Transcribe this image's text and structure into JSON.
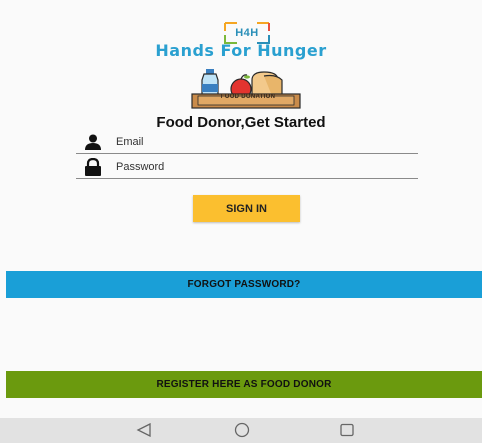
{
  "logo": {
    "badge_text": "H4H",
    "brand_name": "Hands For Hunger"
  },
  "illustration": {
    "box_label": "FOOD DONATION"
  },
  "page": {
    "title": "Food Donor,Get Started"
  },
  "form": {
    "email_placeholder": "Email",
    "password_placeholder": "Password",
    "signin_label": "SIGN IN"
  },
  "links": {
    "forgot_password": "FORGOT PASSWORD?",
    "register": "REGISTER HERE AS FOOD DONOR"
  },
  "icons": {
    "email": "person-icon",
    "password": "lock-icon",
    "nav_back": "back-triangle-icon",
    "nav_home": "home-circle-icon",
    "nav_recents": "recents-square-icon"
  },
  "colors": {
    "brand": "#2aa0d0",
    "signin_button": "#fbbf2f",
    "forgot_bar": "#1a9fd7",
    "register_bar": "#6b9a0e",
    "nav_bar": "#e2e2e2"
  }
}
